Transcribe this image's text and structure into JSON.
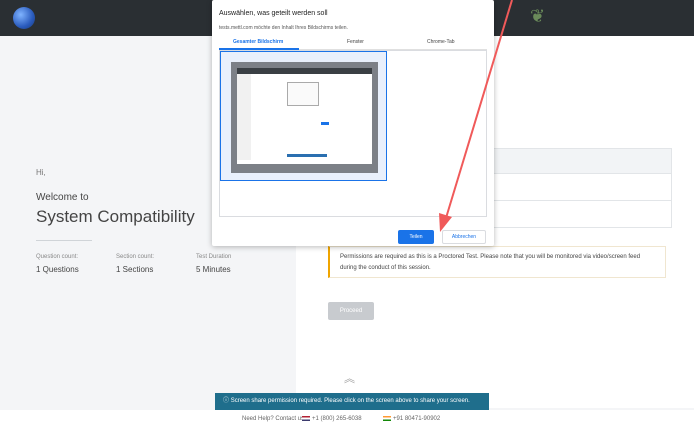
{
  "dialog": {
    "title": "Auswählen, was geteilt werden soll",
    "subtitle": "tests.mettl.com möchte den Inhalt Ihres Bildschirms teilen.",
    "tabs": [
      "Gesamter Bildschirm",
      "Fenster",
      "Chrome-Tab"
    ],
    "share_label": "Teilen",
    "cancel_label": "Abbrechen"
  },
  "left": {
    "greeting": "Hi,",
    "welcome": "Welcome to",
    "title": "System Compatibility",
    "stats": [
      {
        "label": "Question count:",
        "value": "1 Questions"
      },
      {
        "label": "Section count:",
        "value": "1 Sections"
      },
      {
        "label": "Test Duration",
        "value": "5  Minutes"
      }
    ]
  },
  "right": {
    "notice_line1": "Permissions are required as this is a Proctored Test. Please note that you will be monitored via video/screen feed",
    "notice_line2": "during the conduct of this session.",
    "proceed_label": "Proceed"
  },
  "toast": {
    "text": "Screen share permission required. Please click on the screen above to share your screen."
  },
  "footer": {
    "help": "Need Help? Contact us:",
    "us_phone": "+1 (800) 265-6038",
    "in_phone": "+91 80471-90902"
  },
  "colors": {
    "accent": "#1a73e8",
    "toast_bg": "#1f6e8c",
    "warning_border": "#f0a500",
    "annotation_arrow": "#f05a5a",
    "topbar": "#2a2f33"
  }
}
